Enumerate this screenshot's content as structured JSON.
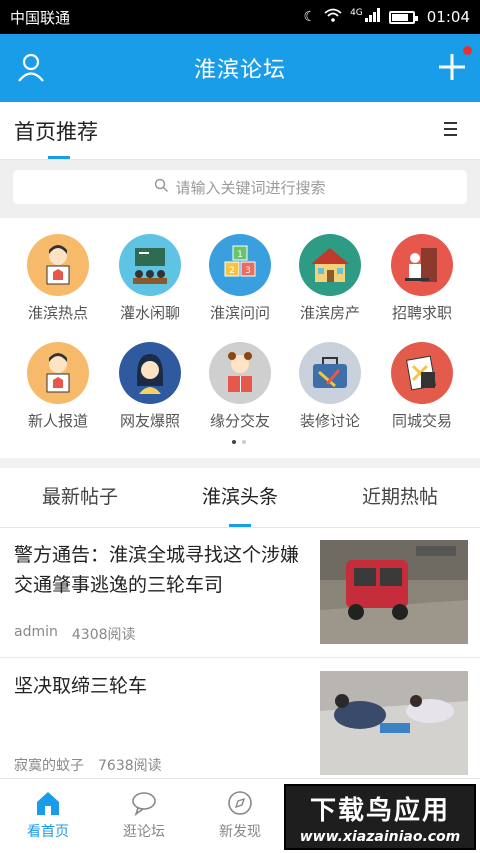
{
  "status_bar": {
    "carrier": "中国联通",
    "network": "4G",
    "time": "01:04",
    "battery_level": 0.8
  },
  "header": {
    "title": "淮滨论坛",
    "user_icon": "user-icon",
    "add_icon": "plus-icon",
    "has_notification": true
  },
  "section": {
    "title": "首页推荐",
    "menu_icon": "menu-icon"
  },
  "search": {
    "placeholder": "请输入关键词进行搜索"
  },
  "categories": [
    {
      "label": "淮滨热点",
      "color": "#f7b96a",
      "icon": "person-sign-icon"
    },
    {
      "label": "灌水闲聊",
      "color": "#5fc3e4",
      "icon": "classroom-icon"
    },
    {
      "label": "淮滨问问",
      "color": "#3a9fde",
      "icon": "blocks-icon"
    },
    {
      "label": "淮滨房产",
      "color": "#2e9b84",
      "icon": "house-icon"
    },
    {
      "label": "招聘求职",
      "color": "#e8574b",
      "icon": "office-worker-icon"
    },
    {
      "label": "新人报道",
      "color": "#f7b96a",
      "icon": "person-sign-icon"
    },
    {
      "label": "网友爆照",
      "color": "#2f5aa0",
      "icon": "girl-icon"
    },
    {
      "label": "缘分交友",
      "color": "#cfcfcf",
      "icon": "reader-girl-icon"
    },
    {
      "label": "装修讨论",
      "color": "#c9d1dc",
      "icon": "toolbag-icon"
    },
    {
      "label": "同城交易",
      "color": "#e35b4b",
      "icon": "calculator-icon"
    }
  ],
  "tabs": [
    {
      "label": "最新帖子",
      "active": false
    },
    {
      "label": "淮滨头条",
      "active": true
    },
    {
      "label": "近期热帖",
      "active": false
    }
  ],
  "posts": [
    {
      "title": "警方通告：淮滨全城寻找这个涉嫌交通肇事逃逸的三轮车司",
      "author": "admin",
      "views": "4308阅读"
    },
    {
      "title": "坚决取缔三轮车",
      "author": "寂寞的蚊子",
      "views": "7638阅读"
    }
  ],
  "bottom_nav": [
    {
      "label": "看首页",
      "icon": "home-icon",
      "active": true
    },
    {
      "label": "逛论坛",
      "icon": "chat-bubble-icon",
      "active": false
    },
    {
      "label": "新发现",
      "icon": "compass-icon",
      "active": false
    }
  ],
  "watermark": {
    "line1": "下载鸟应用",
    "line2": "www.xiazainiao.com"
  },
  "colors": {
    "accent": "#1a9de8",
    "notification": "#e8322e"
  }
}
